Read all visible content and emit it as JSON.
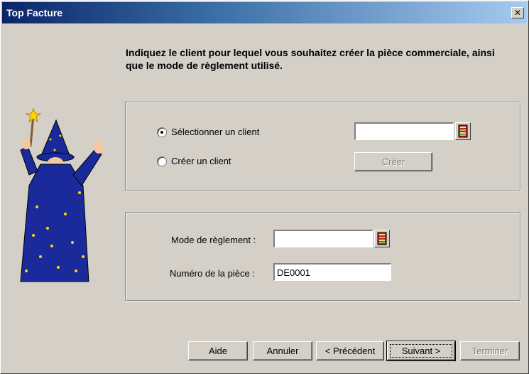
{
  "window": {
    "title": "Top Facture",
    "close_label": "✕"
  },
  "headline": "Indiquez le client pour lequel vous souhaitez créer la pièce commerciale, ainsi que le mode de règlement utilisé.",
  "client_group": {
    "select_label": "Sélectionner un client",
    "create_label": "Créer un client",
    "select_checked": true,
    "client_value": "",
    "create_button": "Créer"
  },
  "payment_group": {
    "mode_label": "Mode de règlement :",
    "mode_value": "",
    "number_label": "Numéro de la pièce :",
    "number_value": "DE0001"
  },
  "buttons": {
    "help": "Aide",
    "cancel": "Annuler",
    "previous": "< Précédent",
    "next": "Suivant >",
    "finish": "Terminer"
  }
}
